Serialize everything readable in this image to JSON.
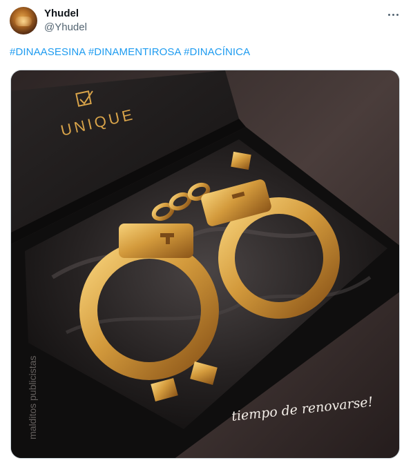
{
  "post": {
    "author_name": "Yhudel",
    "author_handle": "@Yhudel",
    "hashtags": [
      "#DINAASESINA",
      "#DINAMENTIROSA",
      "#DINACÍNICA"
    ]
  },
  "image": {
    "brand_text": "UNIQUE",
    "caption": "tiempo de renovarse!",
    "watermark": "malditos publicistas"
  },
  "colors": {
    "link": "#1d9bf0",
    "gold": "#d9a44a"
  }
}
